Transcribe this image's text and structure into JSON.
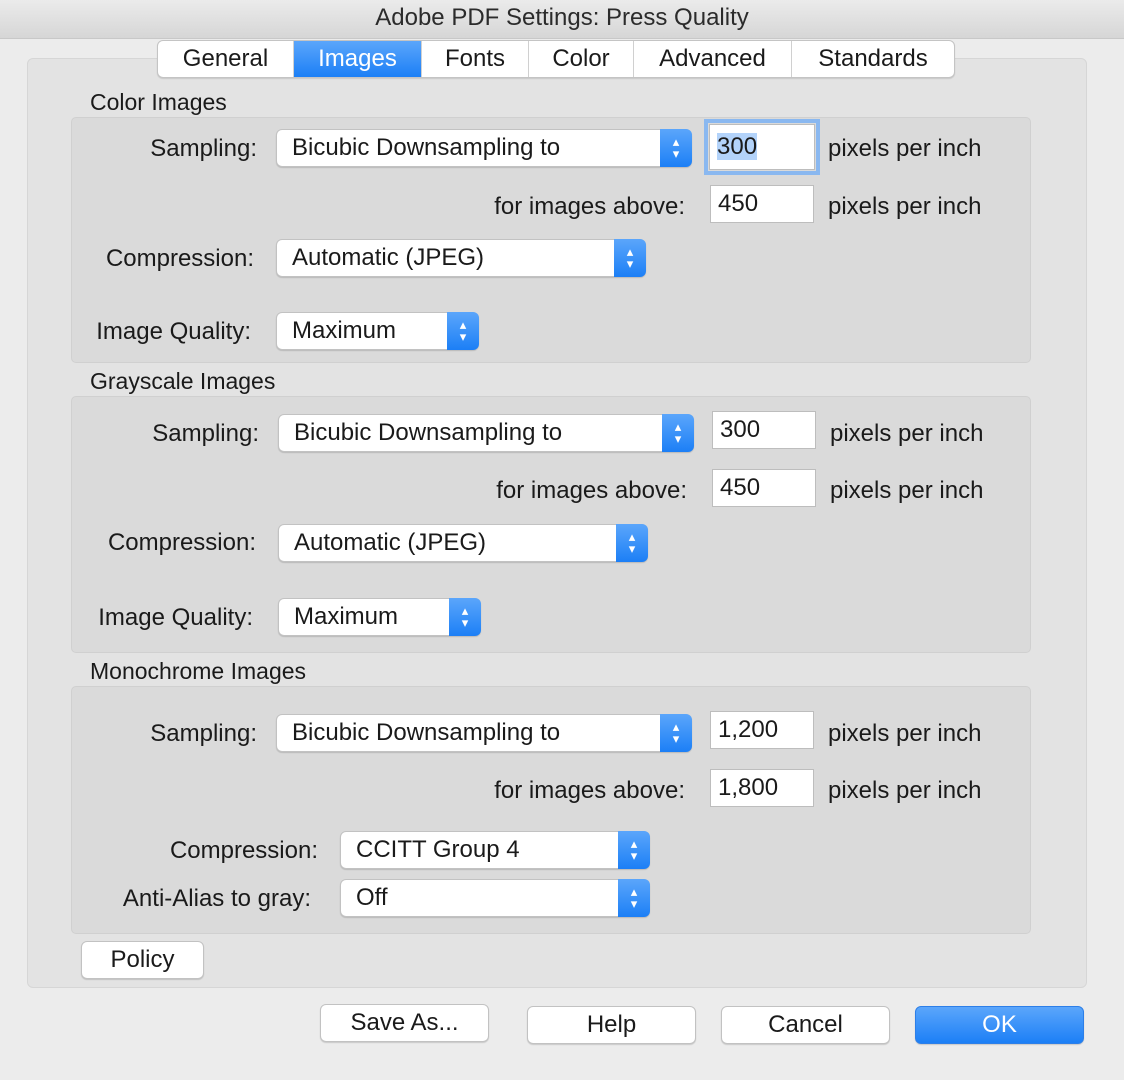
{
  "window": {
    "title": "Adobe PDF Settings: Press Quality"
  },
  "tabs": [
    "General",
    "Images",
    "Fonts",
    "Color",
    "Advanced",
    "Standards"
  ],
  "active_tab": "Images",
  "color_images": {
    "title": "Color Images",
    "sampling_label": "Sampling:",
    "sampling_value": "Bicubic Downsampling to",
    "resolution": "300",
    "resolution_unit": "pixels per inch",
    "above_label": "for images above:",
    "above_value": "450",
    "above_unit": "pixels per inch",
    "compression_label": "Compression:",
    "compression_value": "Automatic (JPEG)",
    "quality_label": "Image Quality:",
    "quality_value": "Maximum"
  },
  "grayscale_images": {
    "title": "Grayscale Images",
    "sampling_label": "Sampling:",
    "sampling_value": "Bicubic Downsampling to",
    "resolution": "300",
    "resolution_unit": "pixels per inch",
    "above_label": "for images above:",
    "above_value": "450",
    "above_unit": "pixels per inch",
    "compression_label": "Compression:",
    "compression_value": "Automatic (JPEG)",
    "quality_label": "Image Quality:",
    "quality_value": "Maximum"
  },
  "monochrome_images": {
    "title": "Monochrome Images",
    "sampling_label": "Sampling:",
    "sampling_value": "Bicubic Downsampling to",
    "resolution": "1,200",
    "resolution_unit": "pixels per inch",
    "above_label": "for images above:",
    "above_value": "1,800",
    "above_unit": "pixels per inch",
    "compression_label": "Compression:",
    "compression_value": "CCITT Group 4",
    "antialias_label": "Anti-Alias to gray:",
    "antialias_value": "Off"
  },
  "buttons": {
    "policy": "Policy",
    "save_as": "Save As...",
    "help": "Help",
    "cancel": "Cancel",
    "ok": "OK"
  },
  "colors": {
    "accent": "#1c7ff6",
    "window_bg": "#ececec"
  },
  "icons": {
    "popup_arrows": "chevron-up-down-icon"
  }
}
